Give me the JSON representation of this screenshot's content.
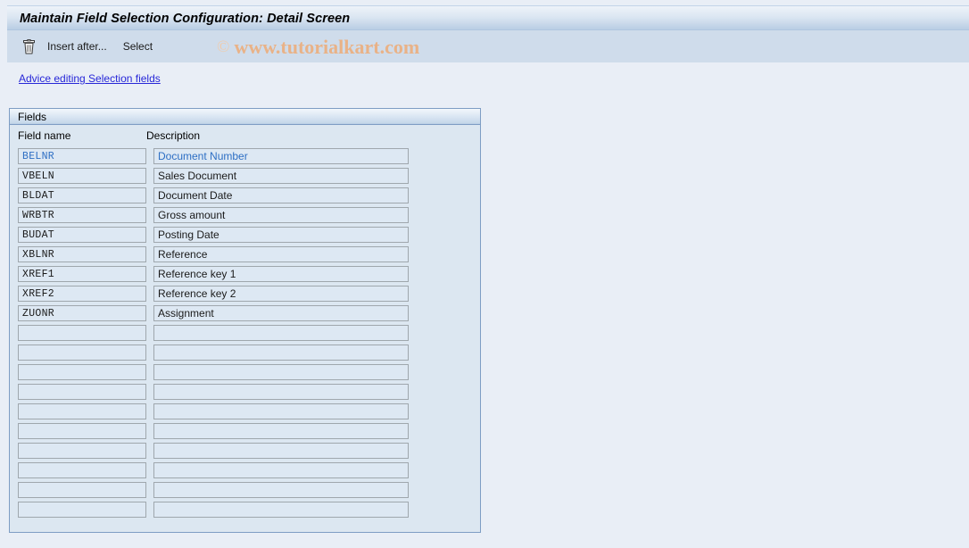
{
  "window": {
    "title": "Maintain Field Selection Configuration: Detail Screen"
  },
  "toolbar": {
    "delete_icon": "trash-icon",
    "insert_after_label": "Insert after...",
    "select_label": "Select"
  },
  "watermark": {
    "copyright_symbol": "©",
    "text": "www.tutorialkart.com",
    "color": "#e9b287"
  },
  "advice": {
    "link_label": "Advice editing Selection fields",
    "color": "#2727d8"
  },
  "fields_panel": {
    "group_title": "Fields",
    "columns": {
      "field_name": "Field name",
      "description": "Description"
    },
    "selected_row_index": 0,
    "selected_color": "#2e6fc4",
    "rows": [
      {
        "field_name": "BELNR",
        "description": "Document Number"
      },
      {
        "field_name": "VBELN",
        "description": "Sales Document"
      },
      {
        "field_name": "BLDAT",
        "description": "Document Date"
      },
      {
        "field_name": "WRBTR",
        "description": "Gross amount"
      },
      {
        "field_name": "BUDAT",
        "description": "Posting Date"
      },
      {
        "field_name": "XBLNR",
        "description": "Reference"
      },
      {
        "field_name": "XREF1",
        "description": "Reference key 1"
      },
      {
        "field_name": "XREF2",
        "description": "Reference key 2"
      },
      {
        "field_name": "ZUONR",
        "description": "Assignment"
      },
      {
        "field_name": "",
        "description": ""
      },
      {
        "field_name": "",
        "description": ""
      },
      {
        "field_name": "",
        "description": ""
      },
      {
        "field_name": "",
        "description": ""
      },
      {
        "field_name": "",
        "description": ""
      },
      {
        "field_name": "",
        "description": ""
      },
      {
        "field_name": "",
        "description": ""
      },
      {
        "field_name": "",
        "description": ""
      },
      {
        "field_name": "",
        "description": ""
      },
      {
        "field_name": "",
        "description": ""
      }
    ]
  },
  "theme": {
    "page_background": "#e9eef6",
    "toolbar_background": "#cfdceb",
    "panel_background": "#dce7f1",
    "panel_border": "#7e9dc4",
    "input_background": "#dde8f3",
    "input_border": "#9fa7ad"
  }
}
